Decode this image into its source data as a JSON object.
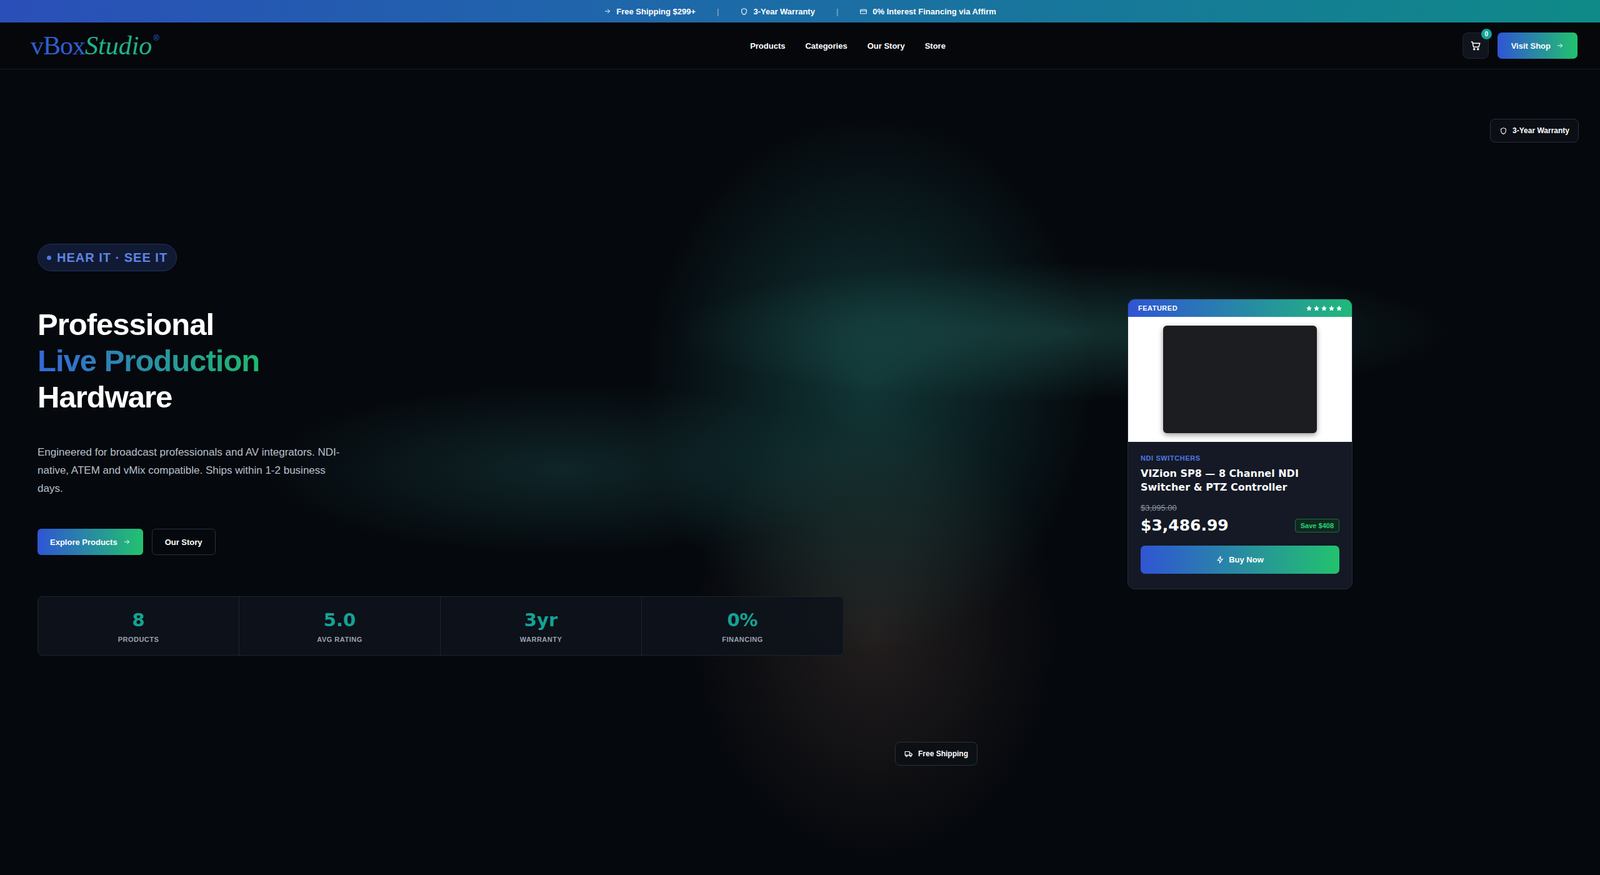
{
  "announcement": {
    "items": [
      "Free Shipping $299+",
      "3-Year Warranty",
      "0% Interest Financing via Affirm"
    ],
    "separator": "|"
  },
  "nav": {
    "logo": {
      "first": "vBox",
      "second": "Studio",
      "mark": "®"
    },
    "links": [
      "Products",
      "Categories",
      "Our Story",
      "Store"
    ],
    "cart_count": "0",
    "cta": "Visit Shop"
  },
  "hero": {
    "eyebrow": "HEAR IT · SEE IT",
    "title": [
      {
        "text": "Professional",
        "kind": "plain"
      },
      {
        "text": "Live Production",
        "kind": "gradient"
      },
      {
        "text": "Hardware",
        "kind": "plain"
      }
    ],
    "description": "Engineered for broadcast professionals and AV integrators. NDI-native, ATEM and vMix compatible. Ships within 1-2 business days.",
    "buttons": [
      {
        "label": "Explore Products",
        "kind": "primary"
      },
      {
        "label": "Our Story",
        "kind": "outline"
      }
    ],
    "stats": [
      {
        "value": "8",
        "label": "PRODUCTS"
      },
      {
        "value": "5.0",
        "label": "AVG RATING"
      },
      {
        "value": "3yr",
        "label": "WARRANTY"
      },
      {
        "value": "0%",
        "label": "FINANCING"
      }
    ]
  },
  "badges": {
    "warranty": "3-Year Warranty",
    "shipping": "Free Shipping"
  },
  "featured": {
    "tag": "FEATURED",
    "stars": 5,
    "category": "NDI SWITCHERS",
    "title": "VIZion SP8 — 8 Channel NDI Switcher & PTZ Controller",
    "old_price": "$3,895.00",
    "price": "$3,486.99",
    "save": "Save $408",
    "button": "Buy Now"
  }
}
